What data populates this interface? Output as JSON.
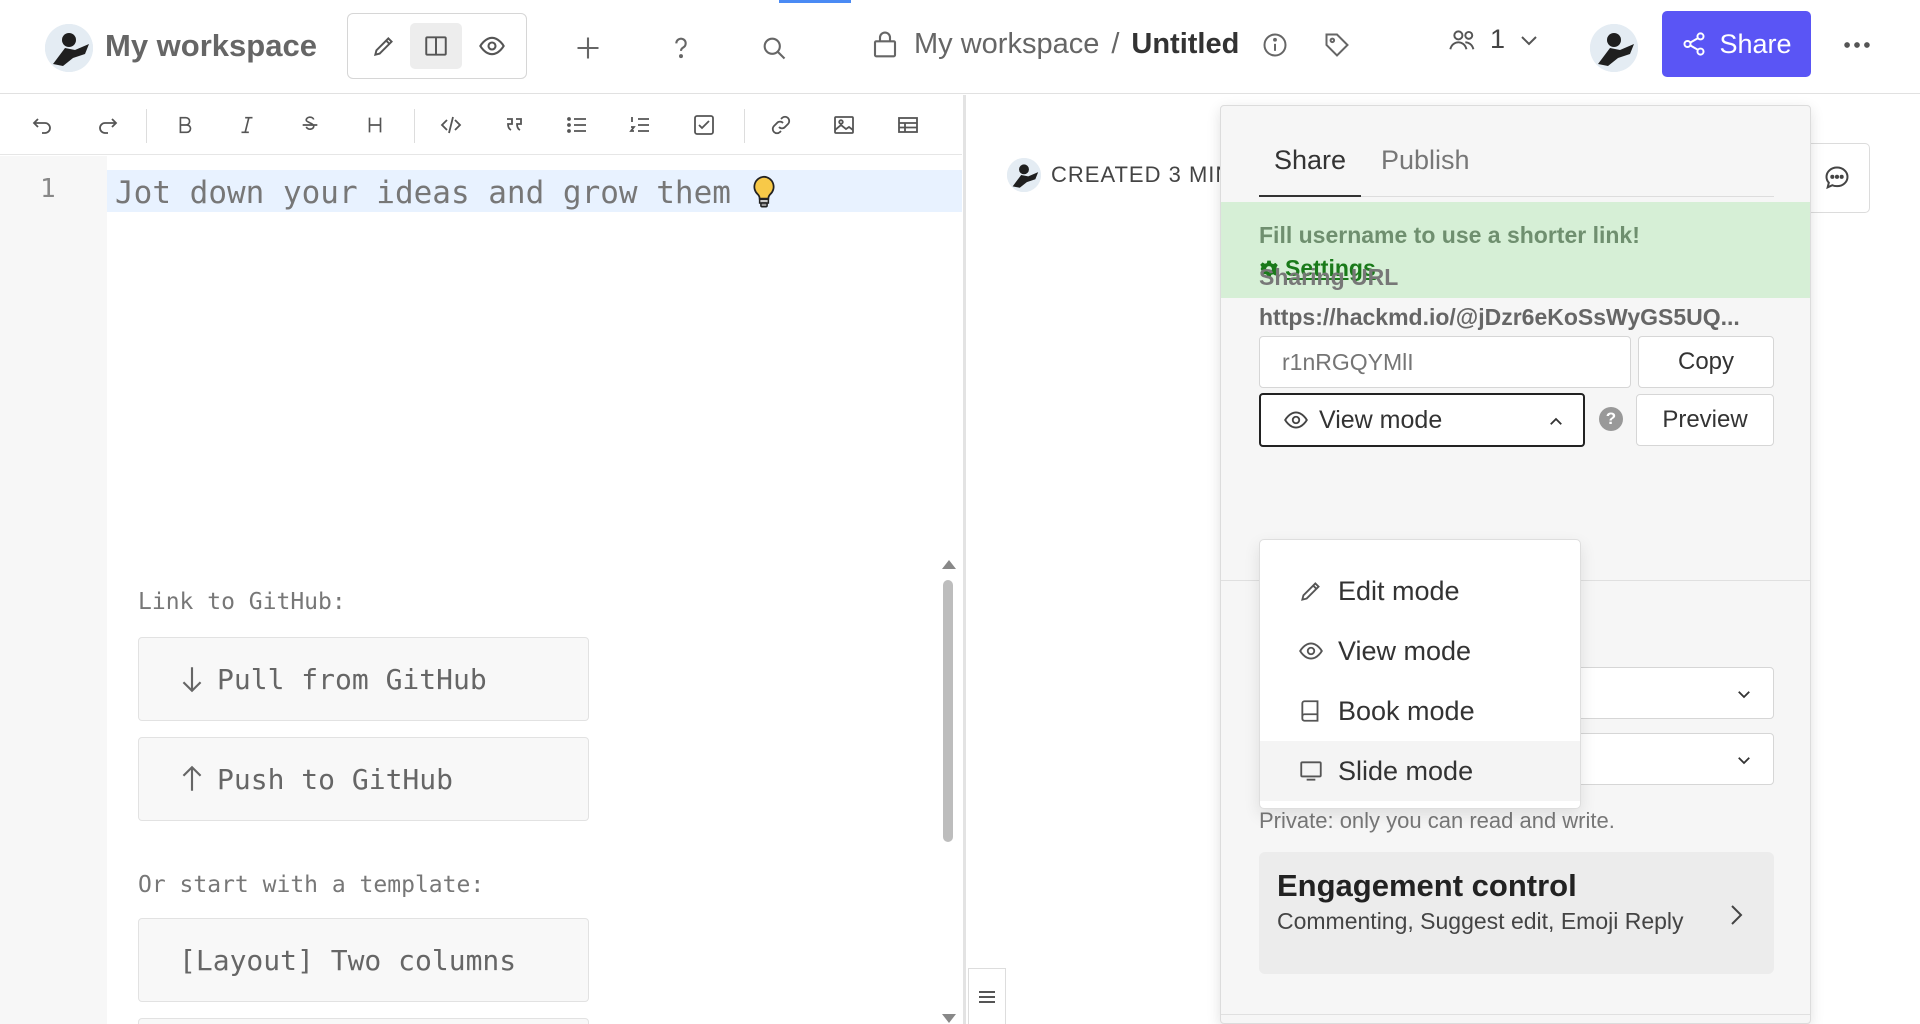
{
  "header": {
    "workspace_title": "My workspace",
    "breadcrumb_workspace": "My workspace",
    "breadcrumb_separator": "/",
    "document_title": "Untitled",
    "online_count": "1",
    "share_label": "Share"
  },
  "editor": {
    "line_number": "1",
    "placeholder_line": "Jot down your ideas and grow them",
    "github_label": "Link to GitHub:",
    "pull_label": "Pull from GitHub",
    "push_label": "Push to GitHub",
    "template_label": "Or start with a template:",
    "template_item": "[Layout] Two columns"
  },
  "preview": {
    "created_text": "CREATED 3 MIN"
  },
  "share_panel": {
    "tabs": [
      "Share",
      "Publish"
    ],
    "notice_text": "Fill username to use a shorter link!",
    "settings_link": "Settings",
    "sharing_url_label": "Sharing URL",
    "sharing_url": "https://hackmd.io/@jDzr6eKoSsWyGS5UQ...",
    "url_input_placeholder": "r1nRGQYMlI",
    "copy_label": "Copy",
    "selected_mode": "View mode",
    "help_glyph": "?",
    "preview_label": "Preview",
    "private_note": "Private: only you can read and write.",
    "engagement_title": "Engagement control",
    "engagement_desc": "Commenting, Suggest edit, Emoji Reply"
  },
  "mode_menu": {
    "items": [
      {
        "label": "Edit mode",
        "icon": "pencil-icon"
      },
      {
        "label": "View mode",
        "icon": "eye-icon"
      },
      {
        "label": "Book mode",
        "icon": "book-icon"
      },
      {
        "label": "Slide mode",
        "icon": "monitor-icon"
      }
    ],
    "hovered": "Slide mode"
  },
  "colors": {
    "brand_share": "#5a55f5",
    "notice_bg": "#d6efd6",
    "notice_link": "#1a7a1a",
    "line_highlight": "#e8f2ff",
    "bulb_yellow": "#f7c948"
  }
}
